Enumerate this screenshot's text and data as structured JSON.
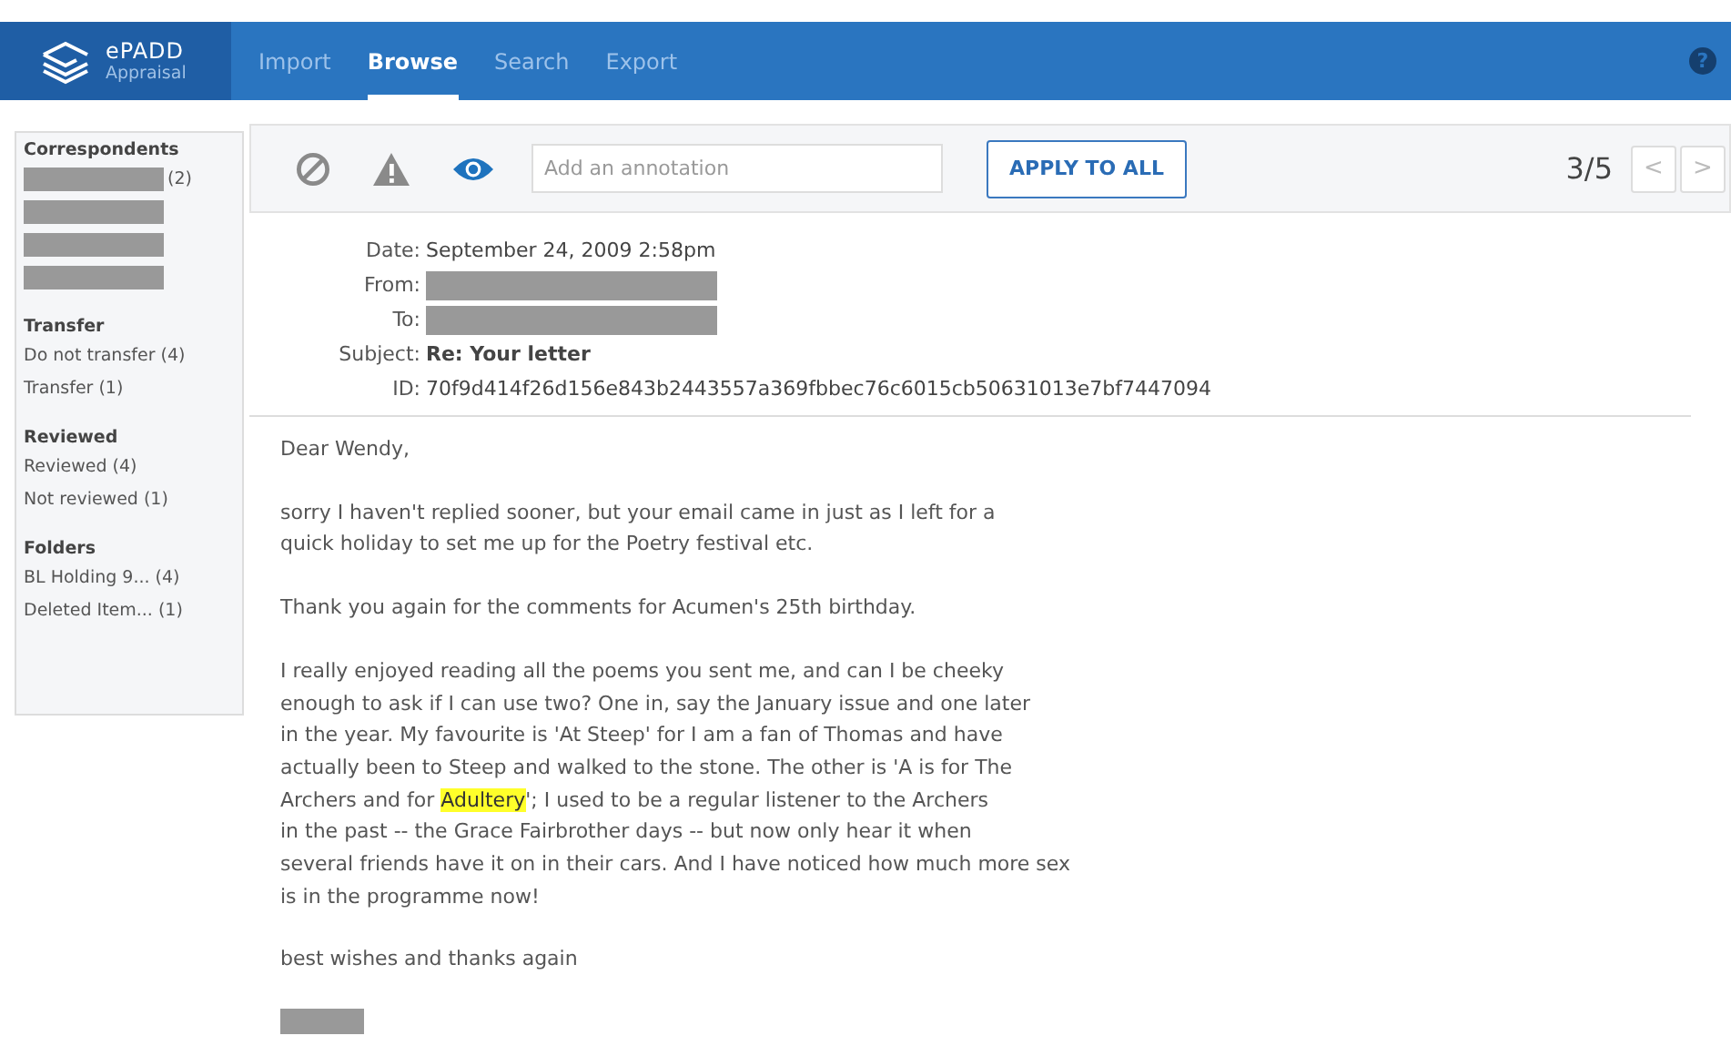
{
  "header": {
    "logo_name": "ePADD",
    "logo_module": "Appraisal",
    "tabs": [
      {
        "label": "Import",
        "selected": false
      },
      {
        "label": "Browse",
        "selected": true
      },
      {
        "label": "Search",
        "selected": false
      },
      {
        "label": "Export",
        "selected": false
      }
    ],
    "help": "?"
  },
  "sidebar": {
    "sections": [
      {
        "title": "Correspondents",
        "items": [
          {
            "redacted": true,
            "label": "(2)"
          },
          {
            "redacted": true
          },
          {
            "redacted": true
          },
          {
            "redacted": true
          }
        ]
      },
      {
        "title": "Transfer",
        "items": [
          {
            "redacted": false,
            "label": "Do not transfer (4)"
          },
          {
            "redacted": false,
            "label": "Transfer (1)"
          }
        ]
      },
      {
        "title": "Reviewed",
        "items": [
          {
            "redacted": false,
            "label": "Reviewed (4)"
          },
          {
            "redacted": false,
            "label": "Not reviewed (1)"
          }
        ]
      },
      {
        "title": "Folders",
        "items": [
          {
            "redacted": false,
            "label": "BL Holding 9... (4)"
          },
          {
            "redacted": false,
            "label": "Deleted Item... (1)"
          }
        ]
      }
    ]
  },
  "toolbar": {
    "annotation": {
      "placeholder": "Add an annotation"
    },
    "apply": "APPLY TO ALL",
    "position": "3/5",
    "prev": "<",
    "next": ">"
  },
  "message": {
    "fields": [
      {
        "label": "Date:",
        "value": "September 24, 2009 2:58pm",
        "kind": "text"
      },
      {
        "label": "From:",
        "kind": "redacted"
      },
      {
        "label": "To:",
        "kind": "redacted"
      },
      {
        "label": "Subject:",
        "value": "Re: Your letter",
        "kind": "bold"
      },
      {
        "label": "ID:",
        "value": "70f9d414f26d156e843b2443557a369fbbec76c6015cb50631013e7bf7447094",
        "kind": "text"
      }
    ],
    "paragraphs": [
      [
        {
          "text": "Dear Wendy,",
          "highlighted": false
        }
      ],
      [
        {
          "text": "sorry I haven't replied sooner, but your email came in just as I left for a\nquick holiday to set me up for the Poetry festival etc.",
          "highlighted": false
        }
      ],
      [
        {
          "text": "Thank you again for the comments for Acumen's 25th birthday.",
          "highlighted": false
        }
      ],
      [
        {
          "text": "I really enjoyed reading all the poems you sent me, and can I be cheeky\nenough to ask if I can use two? One in, say the January issue and one later\nin the year. My favourite is 'At Steep' for I am a fan of Thomas and have\nactually been to Steep and walked to the stone. The other is 'A is for The\nArchers and for ",
          "highlighted": false
        },
        {
          "text": "Adultery",
          "highlighted": true
        },
        {
          "text": "'; I used to be a regular listener to the Archers\nin the past -- the Grace Fairbrother days -- but now only hear it when\nseveral friends have it on in their cars. And I have noticed how much more sex\nis in the programme now!",
          "highlighted": false
        }
      ],
      [
        {
          "text": "best wishes and thanks again",
          "highlighted": false
        }
      ]
    ],
    "signature_redacted": true
  }
}
